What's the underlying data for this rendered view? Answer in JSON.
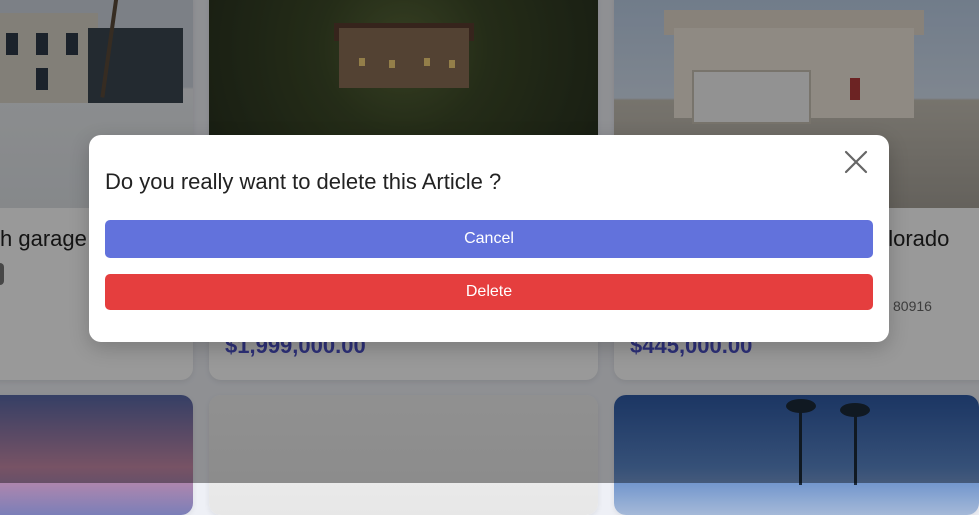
{
  "listings": [
    {
      "title_partial": "h garage",
      "price": ""
    },
    {
      "title_partial": "",
      "price": "$1,999,000.00"
    },
    {
      "title_partial": "olorado",
      "price": "$445,000.00",
      "zip": "80916"
    }
  ],
  "dialog": {
    "title": "Do you really want to delete this Article ?",
    "cancel_label": "Cancel",
    "delete_label": "Delete",
    "close_icon": "close-icon"
  },
  "colors": {
    "cancel": "#6272dc",
    "delete": "#e53e3e",
    "price": "#4b50c9"
  }
}
